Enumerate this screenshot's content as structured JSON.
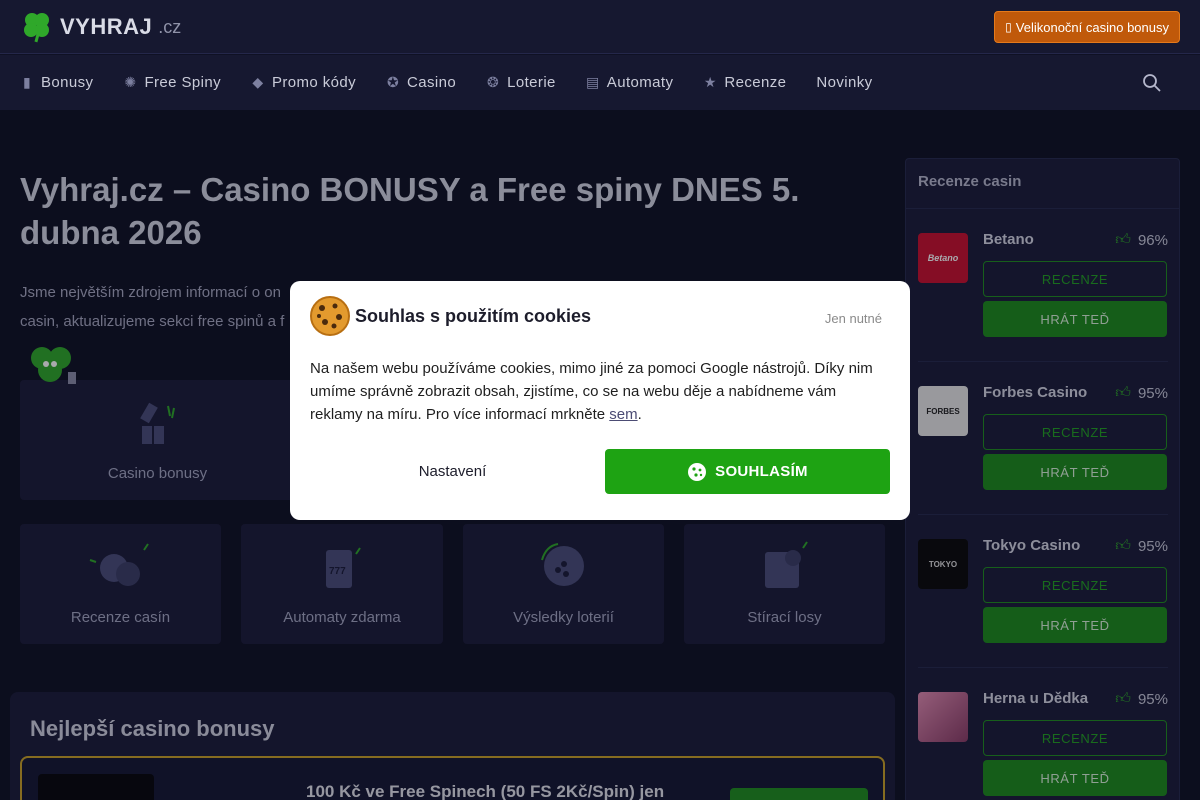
{
  "header": {
    "brand": "VYHRAJ",
    "tld": ".cz",
    "promo_button": "Velikonoční casino bonusy"
  },
  "nav": [
    {
      "label": "Bonusy",
      "icon": "gift-icon"
    },
    {
      "label": "Free Spiny",
      "icon": "spin-wheel-icon"
    },
    {
      "label": "Promo kódy",
      "icon": "ticket-icon"
    },
    {
      "label": "Casino",
      "icon": "chip-icon"
    },
    {
      "label": "Loterie",
      "icon": "lottery-icon"
    },
    {
      "label": "Automaty",
      "icon": "slot-machine-icon"
    },
    {
      "label": "Recenze",
      "icon": "star-icon"
    },
    {
      "label": "Novinky",
      "icon": ""
    }
  ],
  "main": {
    "title": "Vyhraj.cz – Casino BONUSY a Free spiny DNES 5. dubna 2026",
    "intro_line1": "Jsme největším zdrojem informací o on",
    "intro_line2": "casin, aktualizujeme sekci free spinů a f",
    "tiles_top": [
      {
        "label": "Casino bonusy",
        "icon": "gift-icon"
      }
    ],
    "tiles": [
      {
        "label": "Recenze casín",
        "icon": "chat-bubbles-icon"
      },
      {
        "label": "Automaty zdarma",
        "icon": "slot-machine-icon"
      },
      {
        "label": "Výsledky loterií",
        "icon": "lottery-ball-icon"
      },
      {
        "label": "Stírací losy",
        "icon": "scratch-card-icon"
      }
    ],
    "best_bonuses": {
      "heading": "Nejlepší casino bonusy",
      "first_title": "100 Kč ve Free Spinech (50 FS 2Kč/Spin) jen"
    }
  },
  "sidebar": {
    "heading": "Recenze casin",
    "review_label": "RECENZE",
    "play_label": "HRÁT TEĎ",
    "casinos": [
      {
        "name": "Betano",
        "rating": "96%",
        "logo_text": "Betano",
        "logo_bg": "#c8102e"
      },
      {
        "name": "Forbes Casino",
        "rating": "95%",
        "logo_text": "FORBES",
        "logo_bg": "#e6e6e6"
      },
      {
        "name": "Tokyo Casino",
        "rating": "95%",
        "logo_text": "TOKYO",
        "logo_bg": "#0a0a0a"
      },
      {
        "name": "Herna u Dědka",
        "rating": "95%",
        "logo_text": "",
        "logo_bg": "#c2628a"
      }
    ]
  },
  "cookie_modal": {
    "title": "Souhlas s použitím cookies",
    "necessary_only": "Jen nutné",
    "text": "Na našem webu používáme cookies, mimo jiné za pomoci Google nástrojů. Díky nim umíme správně zobrazit obsah, zjistíme, co se na webu děje a nabídneme vám reklamy na míru. Pro více informací mrkněte ",
    "link_text": "sem",
    "text_end": ".",
    "settings_label": "Nastavení",
    "agree_label": "SOUHLASÍM"
  },
  "colors": {
    "background": "#0f1124",
    "panel": "#1b1d3a",
    "accent_green": "#1ea313",
    "promo_orange": "#c0590a",
    "gold_border": "#c9a227"
  }
}
